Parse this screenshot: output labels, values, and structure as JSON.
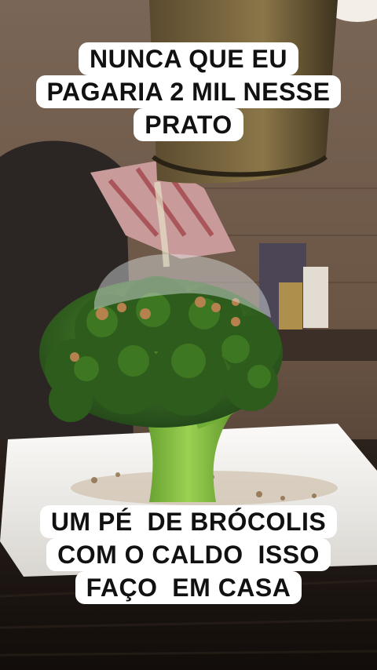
{
  "captions": {
    "top": [
      "NUNCA QUE EU",
      "PAGARIA 2 MIL NESSE",
      "PRATO"
    ],
    "bottom": [
      "UM PÉ  DE BRÓCOLIS",
      "COM O CALDO  ISSO",
      "FAÇO  EM CASA"
    ]
  },
  "colors": {
    "broccoli": "#3f7a22",
    "broccoli_dark": "#2a5618",
    "stem": "#7dbb3e",
    "plate": "#f3f1ee",
    "wood_wall": "#6e5848",
    "caption_bg": "#ffffff",
    "caption_text": "#111111"
  }
}
